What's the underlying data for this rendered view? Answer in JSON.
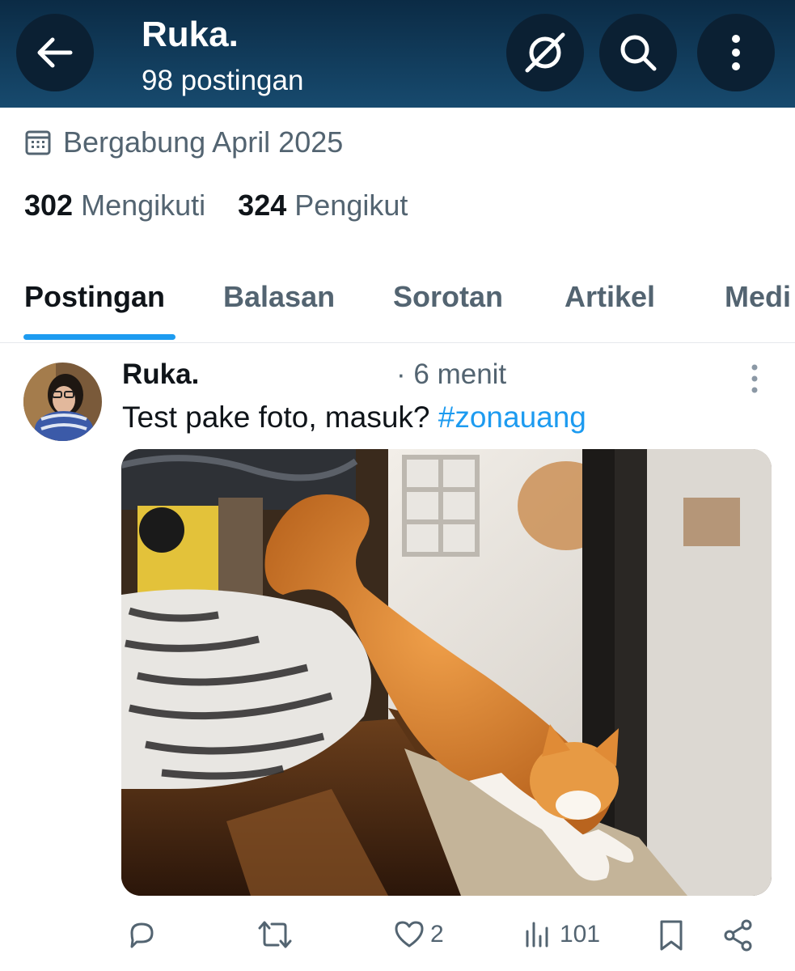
{
  "header": {
    "title": "Ruka.",
    "subtitle": "98 postingan",
    "icons": [
      "arrow-left-icon",
      "grok-icon",
      "search-icon",
      "more-vertical-icon"
    ]
  },
  "profile": {
    "joined": "Bergabung April 2025",
    "following_count": "302",
    "following_label": "Mengikuti",
    "followers_count": "324",
    "followers_label": "Pengikut"
  },
  "tabs": [
    {
      "label": "Postingan",
      "active": true
    },
    {
      "label": "Balasan",
      "active": false
    },
    {
      "label": "Sorotan",
      "active": false
    },
    {
      "label": "Artikel",
      "active": false
    },
    {
      "label": "Medi",
      "active": false
    }
  ],
  "post": {
    "author": "Ruka.",
    "time": "· 6 menit",
    "text": "Test pake foto, masuk? ",
    "hashtag": "#zonauang",
    "image_alt_icon": "cat-photo",
    "actions": {
      "reply_count": "",
      "repost_count": "",
      "like_count": "2",
      "views_count": "101"
    }
  },
  "colors": {
    "header_top": "#0b2b45",
    "header_bottom": "#174a6e",
    "accent": "#1d9bf0",
    "muted_text": "#536471",
    "text": "#0f1419"
  }
}
